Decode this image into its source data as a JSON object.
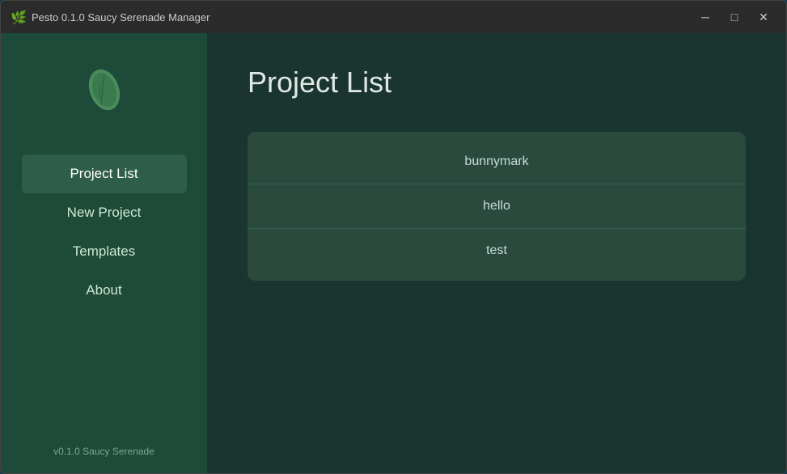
{
  "titlebar": {
    "title": "Pesto 0.1.0 Saucy Serenade Manager",
    "icon": "🌿"
  },
  "window_controls": {
    "minimize": "─",
    "maximize": "□",
    "close": "✕"
  },
  "sidebar": {
    "nav_items": [
      {
        "id": "project-list",
        "label": "Project List",
        "active": true
      },
      {
        "id": "new-project",
        "label": "New Project",
        "active": false
      },
      {
        "id": "templates",
        "label": "Templates",
        "active": false
      },
      {
        "id": "about",
        "label": "About",
        "active": false
      }
    ],
    "version": "v0.1.0 Saucy Serenade"
  },
  "main": {
    "page_title": "Project List",
    "projects": [
      {
        "name": "bunnymark"
      },
      {
        "name": "hello"
      },
      {
        "name": "test"
      }
    ]
  }
}
